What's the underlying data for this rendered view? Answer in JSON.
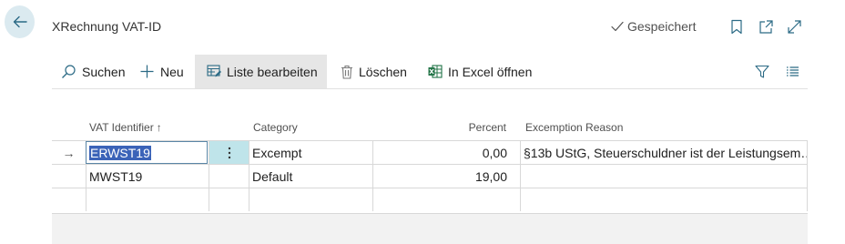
{
  "header": {
    "title": "XRechnung VAT-ID",
    "saved_status": "Gespeichert"
  },
  "actions": {
    "search": "Suchen",
    "new": "Neu",
    "edit_list": "Liste bearbeiten",
    "delete": "Löschen",
    "open_excel": "In Excel öffnen"
  },
  "table": {
    "columns": {
      "vat_identifier": "VAT Identifier",
      "sort_indicator": "↑",
      "category": "Category",
      "percent": "Percent",
      "exemption_reason": "Excemption Reason"
    },
    "rows": [
      {
        "vat_identifier": "ERWST19",
        "category": "Excempt",
        "percent": "0,00",
        "exemption_reason": "§13b UStG, Steuerschuldner ist der Leistungsem…",
        "row_marker": "→"
      },
      {
        "vat_identifier": "MWST19",
        "category": "Default",
        "percent": "19,00",
        "exemption_reason": "",
        "row_marker": ""
      }
    ]
  },
  "icons": {
    "back": "arrow-left-icon",
    "saved": "checkmark-icon",
    "bookmark": "bookmark-icon",
    "open_new": "open-in-new-window-icon",
    "expand": "expand-icon",
    "search": "search-icon",
    "new": "plus-icon",
    "edit_list": "edit-list-icon",
    "delete": "trash-icon",
    "excel": "excel-icon",
    "filter": "filter-icon",
    "list_view": "list-view-icon",
    "row_actions": "more-vertical-icon"
  },
  "colors": {
    "accent": "#3b63b8",
    "back_button_bg": "#dbeaf0",
    "row_action_bg": "#bfe4ea"
  }
}
